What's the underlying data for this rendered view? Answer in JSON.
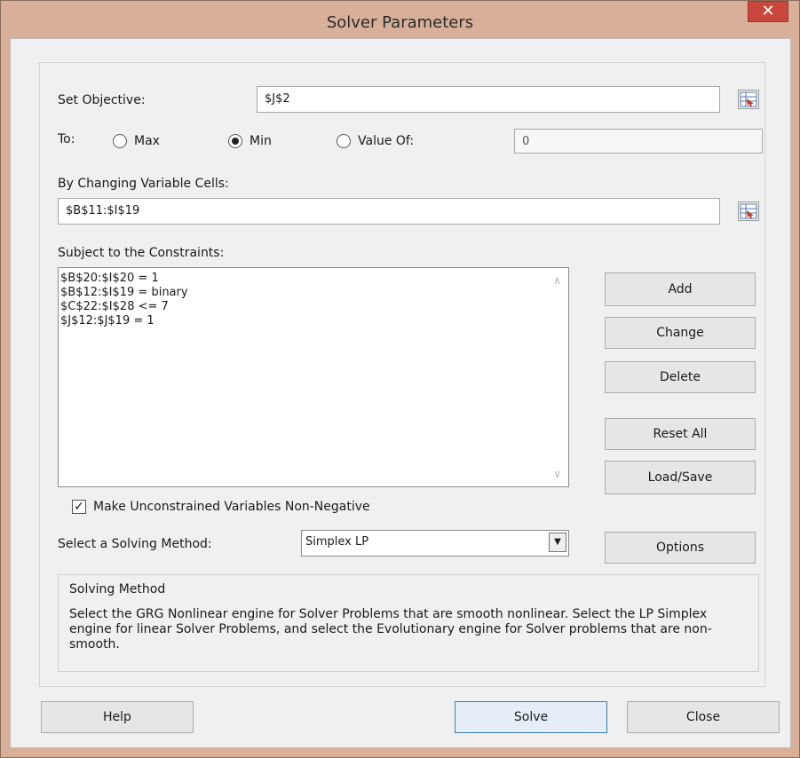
{
  "window": {
    "title": "Solver Parameters",
    "close_glyph": "✕"
  },
  "objective": {
    "label": "Set Objective:",
    "value": "$J$2"
  },
  "to": {
    "label": "To:",
    "max_label": "Max",
    "min_label": "Min",
    "value_of_label": "Value Of:",
    "value_of_value": "0",
    "selected": "Min"
  },
  "variables": {
    "label": "By Changing Variable Cells:",
    "value": "$B$11:$I$19"
  },
  "constraints": {
    "label": "Subject to the Constraints:",
    "items": [
      "$B$20:$I$20 = 1",
      "$B$12:$I$19 = binary",
      "$C$22:$I$28 <= 7",
      "$J$12:$J$19 = 1"
    ]
  },
  "side_buttons": {
    "add": "Add",
    "change": "Change",
    "delete": "Delete",
    "reset_all": "Reset All",
    "load_save": "Load/Save",
    "options": "Options"
  },
  "nonneg": {
    "label": "Make Unconstrained Variables Non-Negative",
    "checked": true,
    "check_glyph": "✓"
  },
  "method": {
    "label": "Select a Solving Method:",
    "value": "Simplex LP",
    "arrow_glyph": "▼"
  },
  "solving_method_box": {
    "title": "Solving Method",
    "text": "Select the GRG Nonlinear engine for Solver Problems that are smooth nonlinear. Select the LP Simplex engine for linear Solver Problems, and select the Evolutionary engine for Solver problems that are non-smooth."
  },
  "bottom": {
    "help": "Help",
    "solve": "Solve",
    "close": "Close"
  },
  "icons": {
    "scroll_up": "∧",
    "scroll_down": "∨"
  }
}
